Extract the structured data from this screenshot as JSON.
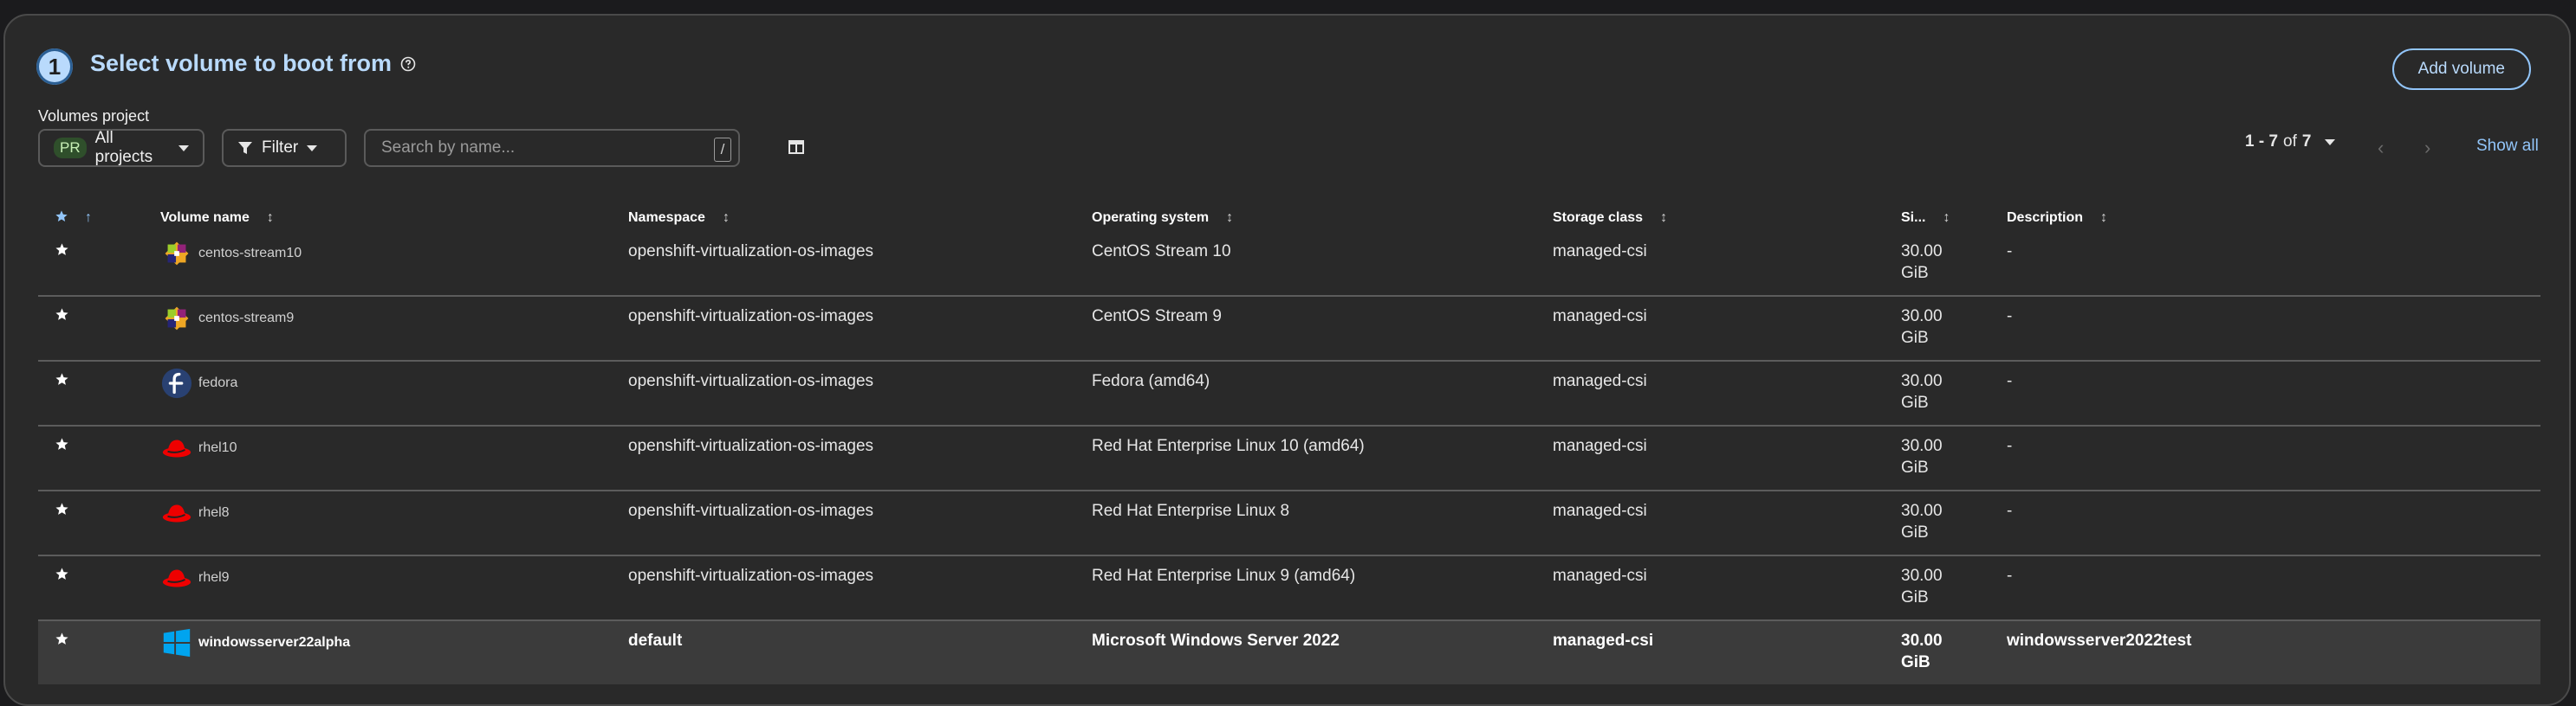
{
  "header": {
    "step": "1",
    "title": "Select volume to boot from",
    "add_volume_label": "Add volume"
  },
  "toolbar": {
    "volumes_project_label": "Volumes project",
    "project_badge": "PR",
    "project_value": "All projects",
    "filter_label": "Filter",
    "search_placeholder": "Search by name...",
    "search_shortcut": "/"
  },
  "pagination": {
    "range": "1 - 7",
    "of": "of",
    "total": "7",
    "show_all": "Show all"
  },
  "table": {
    "columns": [
      "Volume name",
      "Namespace",
      "Operating system",
      "Storage class",
      "Si...",
      "Description"
    ],
    "rows": [
      {
        "name": "centos-stream10",
        "icon": "centos-icon",
        "namespace": "openshift-virtualization-os-images",
        "os": "CentOS Stream 10",
        "storage": "managed-csi",
        "size_value": "30.00",
        "size_unit": "GiB",
        "description": "-"
      },
      {
        "name": "centos-stream9",
        "icon": "centos-icon",
        "namespace": "openshift-virtualization-os-images",
        "os": "CentOS Stream 9",
        "storage": "managed-csi",
        "size_value": "30.00",
        "size_unit": "GiB",
        "description": "-"
      },
      {
        "name": "fedora",
        "icon": "fedora-icon",
        "namespace": "openshift-virtualization-os-images",
        "os": "Fedora (amd64)",
        "storage": "managed-csi",
        "size_value": "30.00",
        "size_unit": "GiB",
        "description": "-"
      },
      {
        "name": "rhel10",
        "icon": "redhat-icon",
        "namespace": "openshift-virtualization-os-images",
        "os": "Red Hat Enterprise Linux 10 (amd64)",
        "storage": "managed-csi",
        "size_value": "30.00",
        "size_unit": "GiB",
        "description": "-"
      },
      {
        "name": "rhel8",
        "icon": "redhat-icon",
        "namespace": "openshift-virtualization-os-images",
        "os": "Red Hat Enterprise Linux 8",
        "storage": "managed-csi",
        "size_value": "30.00",
        "size_unit": "GiB",
        "description": "-"
      },
      {
        "name": "rhel9",
        "icon": "redhat-icon",
        "namespace": "openshift-virtualization-os-images",
        "os": "Red Hat Enterprise Linux 9 (amd64)",
        "storage": "managed-csi",
        "size_value": "30.00",
        "size_unit": "GiB",
        "description": "-"
      },
      {
        "name": "windowsserver22alpha",
        "icon": "windows-icon",
        "namespace": "default",
        "os": "Microsoft Windows Server 2022",
        "storage": "managed-csi",
        "size_value": "30.00",
        "size_unit": "GiB",
        "description": "windowsserver2022test"
      }
    ],
    "selected_row": "windowsserver22alpha"
  },
  "colors": {
    "accent": "#92c5f9",
    "title": "#b9dafc",
    "background": "#292929",
    "selected_row": "#3b3b3b"
  }
}
